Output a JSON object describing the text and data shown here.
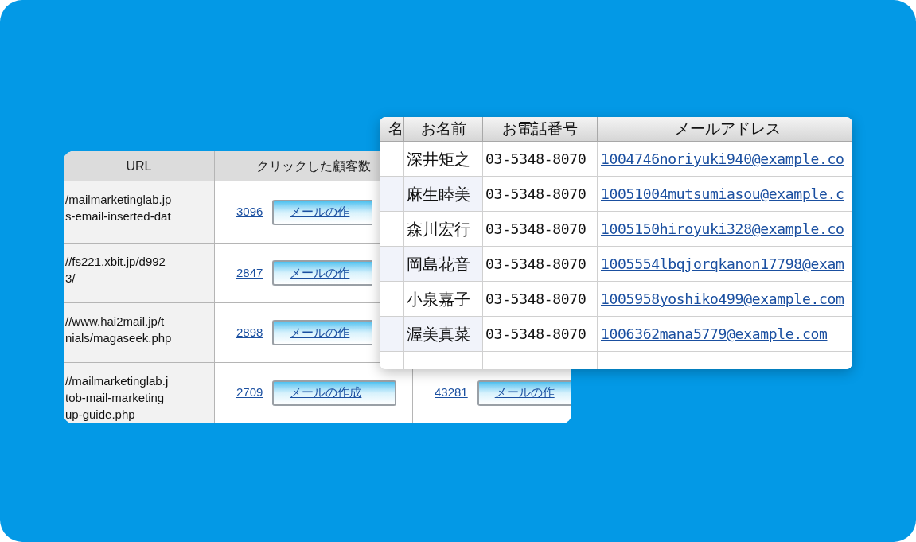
{
  "back_table": {
    "columns": [
      "URL",
      "クリックした顧客数"
    ],
    "rows": [
      {
        "url_lines": [
          "/mailmarketinglab.jp",
          "s-email-inserted-dat"
        ],
        "count": "3096",
        "button": "メールの作"
      },
      {
        "url_lines": [
          "//fs221.xbit.jp/d992",
          "3/"
        ],
        "count": "2847",
        "button": "メールの作"
      },
      {
        "url_lines": [
          "//www.hai2mail.jp/t",
          "nials/magaseek.php"
        ],
        "count": "2898",
        "button": "メールの作"
      },
      {
        "url_lines": [
          "//mailmarketinglab.j",
          "tob-mail-marketing",
          "up-guide.php"
        ],
        "count": "2709",
        "button": "メールの作成",
        "column_3": {
          "count": "43281",
          "button": "メールの作"
        }
      }
    ]
  },
  "front_table": {
    "columns": [
      "名",
      "お名前",
      "お電話番号",
      "メールアドレス"
    ],
    "rows": [
      {
        "name": "深井矩之",
        "phone": "03-5348-8070",
        "email": "1004746noriyuki940@example.co"
      },
      {
        "name": "麻生睦美",
        "phone": "03-5348-8070",
        "email": "10051004mutsumiasou@example.c"
      },
      {
        "name": "森川宏行",
        "phone": "03-5348-8070",
        "email": "1005150hiroyuki328@example.co"
      },
      {
        "name": "岡島花音",
        "phone": "03-5348-8070",
        "email": "1005554lbqjorqkanon17798@exam"
      },
      {
        "name": "小泉嘉子",
        "phone": "03-5348-8070",
        "email": "1005958yoshiko499@example.com"
      },
      {
        "name": "渥美真菜",
        "phone": "03-5348-8070",
        "email": "1006362mana5779@example.com"
      }
    ]
  }
}
